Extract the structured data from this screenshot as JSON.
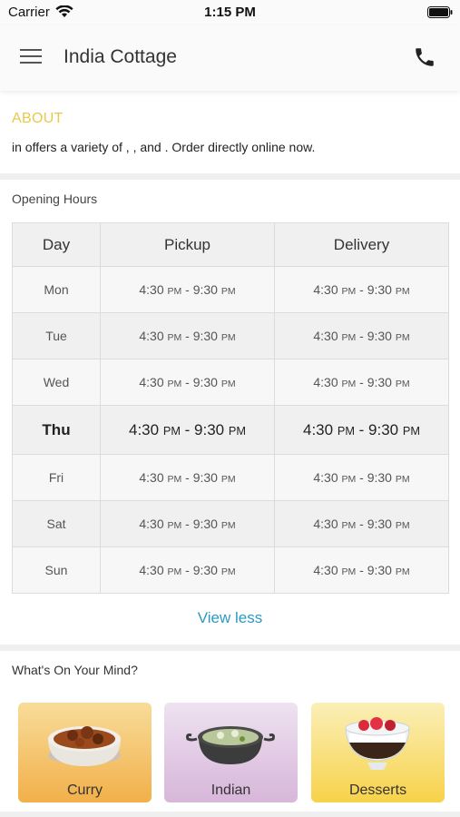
{
  "status_bar": {
    "carrier": "Carrier",
    "time": "1:15 PM",
    "icons": [
      "wifi-icon",
      "battery-icon"
    ]
  },
  "header": {
    "title": "India Cottage",
    "icons": [
      "menu-icon",
      "phone-icon"
    ]
  },
  "about": {
    "heading": "ABOUT",
    "text": "in  offers a variety of , ,  and  . Order directly online now.",
    "accent_color": "#e8c94a"
  },
  "hours": {
    "heading": "Opening Hours",
    "columns": [
      "Day",
      "Pickup",
      "Delivery"
    ],
    "rows": [
      {
        "day": "Mon",
        "pickup_start": "4:30",
        "pickup_end": "9:30",
        "delivery_start": "4:30",
        "delivery_end": "9:30",
        "pm": "PM"
      },
      {
        "day": "Tue",
        "pickup_start": "4:30",
        "pickup_end": "9:30",
        "delivery_start": "4:30",
        "delivery_end": "9:30",
        "pm": "PM"
      },
      {
        "day": "Wed",
        "pickup_start": "4:30",
        "pickup_end": "9:30",
        "delivery_start": "4:30",
        "delivery_end": "9:30",
        "pm": "PM"
      },
      {
        "day": "Thu",
        "pickup_start": "4:30",
        "pickup_end": "9:30",
        "delivery_start": "4:30",
        "delivery_end": "9:30",
        "pm": "PM"
      },
      {
        "day": "Fri",
        "pickup_start": "4:30",
        "pickup_end": "9:30",
        "delivery_start": "4:30",
        "delivery_end": "9:30",
        "pm": "PM"
      },
      {
        "day": "Sat",
        "pickup_start": "4:30",
        "pickup_end": "9:30",
        "delivery_start": "4:30",
        "delivery_end": "9:30",
        "pm": "PM"
      },
      {
        "day": "Sun",
        "pickup_start": "4:30",
        "pickup_end": "9:30",
        "delivery_start": "4:30",
        "delivery_end": "9:30",
        "pm": "PM"
      }
    ],
    "today": "Thu",
    "view_toggle": "View less",
    "link_color": "#2a9ac4"
  },
  "mind": {
    "heading": "What's On Your Mind?",
    "categories": [
      {
        "label": "Curry",
        "icon": "curry-bowl-icon",
        "color_top": "#f8dc9a",
        "color_bottom": "#f2b04a"
      },
      {
        "label": "Indian",
        "icon": "kadai-dish-icon",
        "color_top": "#eee2f0",
        "color_bottom": "#d7b6da"
      },
      {
        "label": "Desserts",
        "icon": "dessert-glass-icon",
        "color_top": "#fbefb8",
        "color_bottom": "#f7d24a"
      }
    ]
  }
}
